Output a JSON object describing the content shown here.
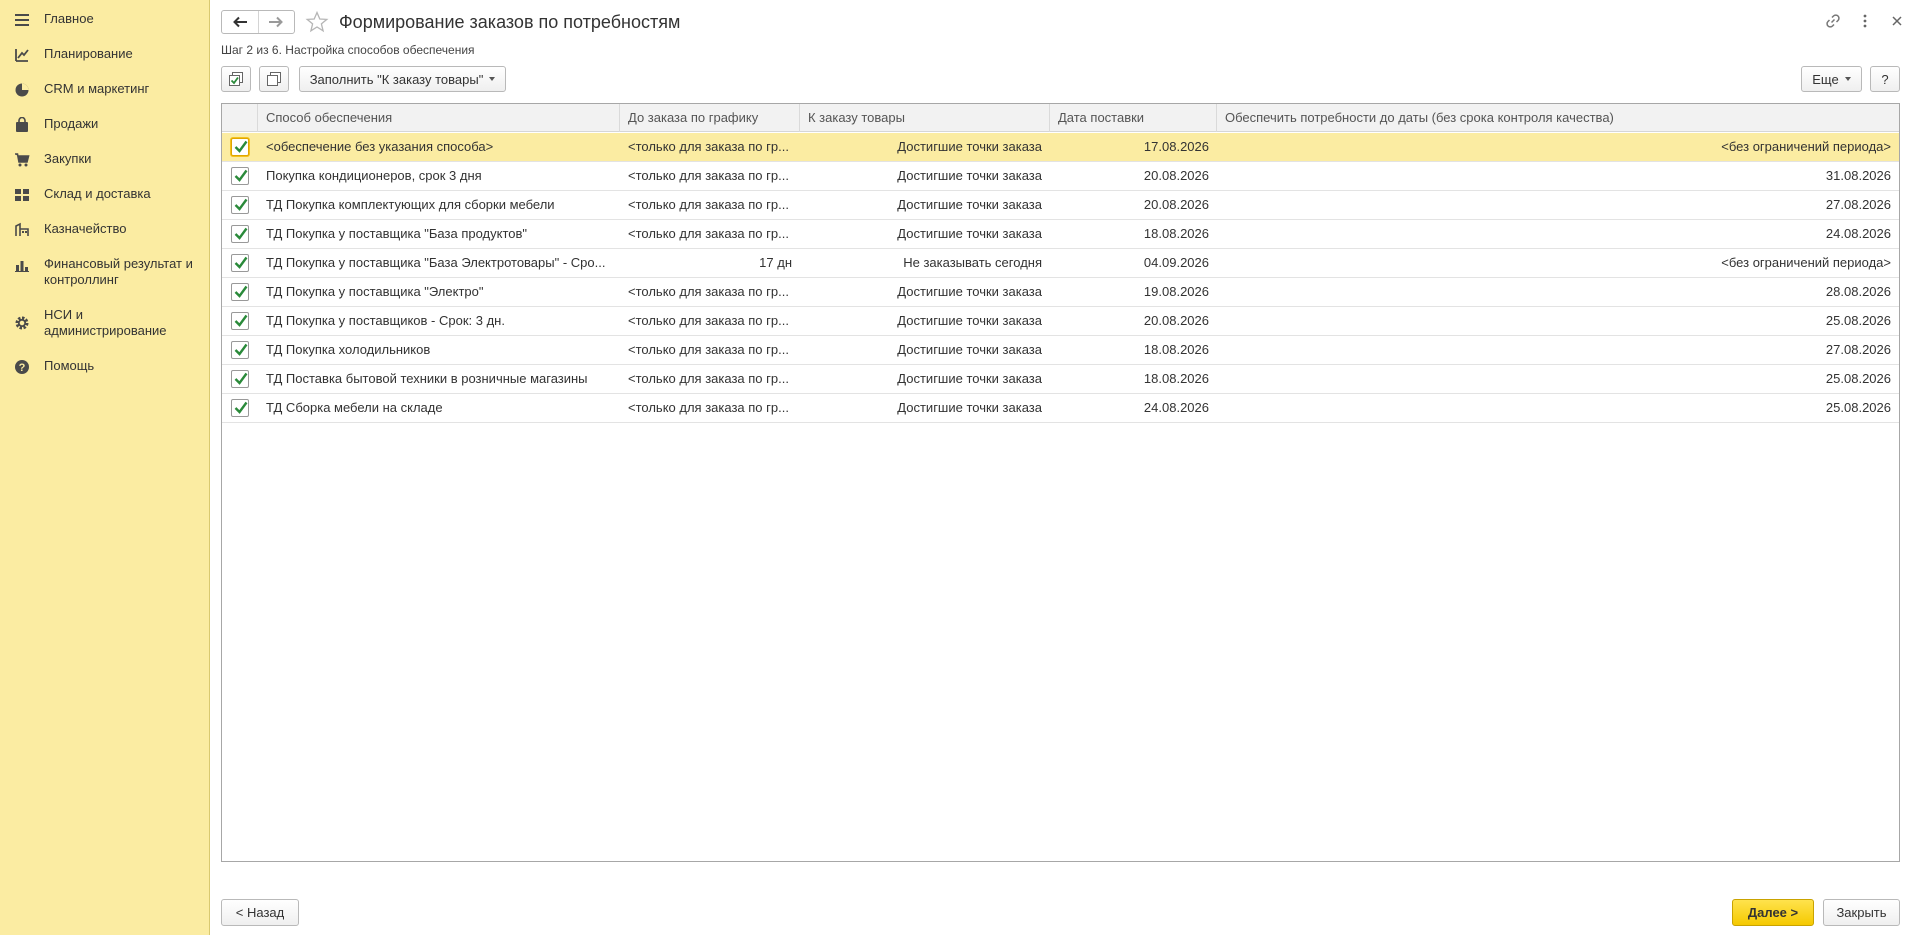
{
  "sidebar": {
    "items": [
      {
        "label": "Главное",
        "icon": "menu-icon"
      },
      {
        "label": "Планирование",
        "icon": "planning-icon"
      },
      {
        "label": "CRM и маркетинг",
        "icon": "pie-chart-icon"
      },
      {
        "label": "Продажи",
        "icon": "bag-icon"
      },
      {
        "label": "Закупки",
        "icon": "cart-icon"
      },
      {
        "label": "Склад и доставка",
        "icon": "warehouse-icon"
      },
      {
        "label": "Казначейство",
        "icon": "treasury-icon"
      },
      {
        "label": "Финансовый результат и контроллинг",
        "icon": "bar-chart-icon"
      },
      {
        "label": "НСИ и администрирование",
        "icon": "gear-icon"
      },
      {
        "label": "Помощь",
        "icon": "help-icon"
      }
    ]
  },
  "header": {
    "title": "Формирование заказов по потребностям",
    "step": "Шаг 2 из 6. Настройка способов обеспечения"
  },
  "toolbar": {
    "fill_label": "Заполнить \"К заказу товары\"",
    "more_label": "Еще",
    "help_label": "?"
  },
  "table": {
    "columns": [
      "Способ обеспечения",
      "До заказа по графику",
      "К заказу товары",
      "Дата поставки",
      "Обеспечить потребности до даты (без срока контроля качества)"
    ],
    "rows": [
      {
        "checked": true,
        "method": "<обеспечение без указания способа>",
        "schedule": "<только для заказа по гр...",
        "order": "Достигшие точки заказа",
        "delivery": "17.08.2026",
        "until": "<без ограничений периода>"
      },
      {
        "checked": true,
        "method": "Покупка кондиционеров, срок 3 дня",
        "schedule": "<только для заказа по гр...",
        "order": "Достигшие точки заказа",
        "delivery": "20.08.2026",
        "until": "31.08.2026"
      },
      {
        "checked": true,
        "method": "ТД Покупка комплектующих для сборки мебели",
        "schedule": "<только для заказа по гр...",
        "order": "Достигшие точки заказа",
        "delivery": "20.08.2026",
        "until": "27.08.2026"
      },
      {
        "checked": true,
        "method": "ТД Покупка у поставщика \"База продуктов\"",
        "schedule": "<только для заказа по гр...",
        "order": "Достигшие точки заказа",
        "delivery": "18.08.2026",
        "until": "24.08.2026"
      },
      {
        "checked": true,
        "method": "ТД Покупка у поставщика \"База Электротовары\" - Сро...",
        "schedule": "17 дн",
        "order": "Не заказывать сегодня",
        "delivery": "04.09.2026",
        "until": "<без ограничений периода>"
      },
      {
        "checked": true,
        "method": "ТД Покупка у поставщика \"Электро\"",
        "schedule": "<только для заказа по гр...",
        "order": "Достигшие точки заказа",
        "delivery": "19.08.2026",
        "until": "28.08.2026"
      },
      {
        "checked": true,
        "method": "ТД Покупка у поставщиков - Срок: 3 дн.",
        "schedule": "<только для заказа по гр...",
        "order": "Достигшие точки заказа",
        "delivery": "20.08.2026",
        "until": "25.08.2026"
      },
      {
        "checked": true,
        "method": "ТД Покупка холодильников",
        "schedule": "<только для заказа по гр...",
        "order": "Достигшие точки заказа",
        "delivery": "18.08.2026",
        "until": "27.08.2026"
      },
      {
        "checked": true,
        "method": "ТД Поставка бытовой техники в розничные магазины",
        "schedule": "<только для заказа по гр...",
        "order": "Достигшие точки заказа",
        "delivery": "18.08.2026",
        "until": "25.08.2026"
      },
      {
        "checked": true,
        "method": "ТД Сборка мебели на складе",
        "schedule": "<только для заказа по гр...",
        "order": "Достигшие точки заказа",
        "delivery": "24.08.2026",
        "until": "25.08.2026"
      }
    ]
  },
  "footer": {
    "back_label": "< Назад",
    "next_label": "Далее >",
    "close_label": "Закрыть"
  },
  "colors": {
    "sidebar_bg": "#fbeca2",
    "selected_row": "#fbeca2",
    "primary_button": "#f5c900",
    "check_green": "#2a8a3a"
  }
}
